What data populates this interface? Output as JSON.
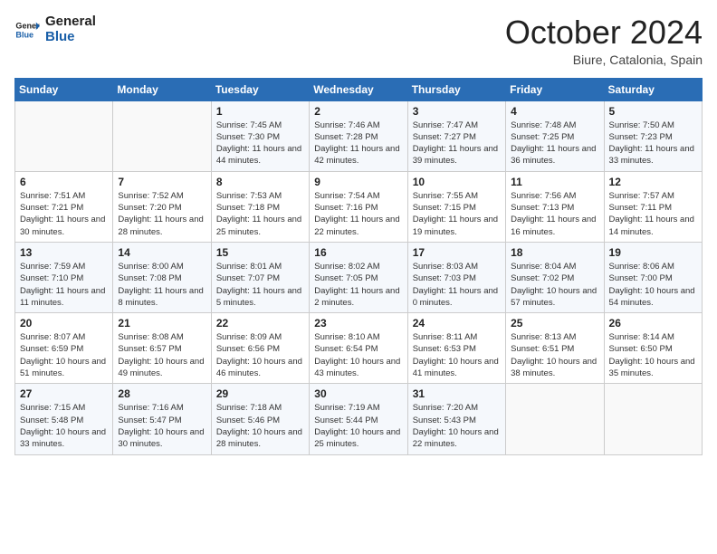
{
  "header": {
    "logo_line1": "General",
    "logo_line2": "Blue",
    "month": "October 2024",
    "location": "Biure, Catalonia, Spain"
  },
  "days_of_week": [
    "Sunday",
    "Monday",
    "Tuesday",
    "Wednesday",
    "Thursday",
    "Friday",
    "Saturday"
  ],
  "weeks": [
    [
      {
        "day": "",
        "info": ""
      },
      {
        "day": "",
        "info": ""
      },
      {
        "day": "1",
        "info": "Sunrise: 7:45 AM\nSunset: 7:30 PM\nDaylight: 11 hours and 44 minutes."
      },
      {
        "day": "2",
        "info": "Sunrise: 7:46 AM\nSunset: 7:28 PM\nDaylight: 11 hours and 42 minutes."
      },
      {
        "day": "3",
        "info": "Sunrise: 7:47 AM\nSunset: 7:27 PM\nDaylight: 11 hours and 39 minutes."
      },
      {
        "day": "4",
        "info": "Sunrise: 7:48 AM\nSunset: 7:25 PM\nDaylight: 11 hours and 36 minutes."
      },
      {
        "day": "5",
        "info": "Sunrise: 7:50 AM\nSunset: 7:23 PM\nDaylight: 11 hours and 33 minutes."
      }
    ],
    [
      {
        "day": "6",
        "info": "Sunrise: 7:51 AM\nSunset: 7:21 PM\nDaylight: 11 hours and 30 minutes."
      },
      {
        "day": "7",
        "info": "Sunrise: 7:52 AM\nSunset: 7:20 PM\nDaylight: 11 hours and 28 minutes."
      },
      {
        "day": "8",
        "info": "Sunrise: 7:53 AM\nSunset: 7:18 PM\nDaylight: 11 hours and 25 minutes."
      },
      {
        "day": "9",
        "info": "Sunrise: 7:54 AM\nSunset: 7:16 PM\nDaylight: 11 hours and 22 minutes."
      },
      {
        "day": "10",
        "info": "Sunrise: 7:55 AM\nSunset: 7:15 PM\nDaylight: 11 hours and 19 minutes."
      },
      {
        "day": "11",
        "info": "Sunrise: 7:56 AM\nSunset: 7:13 PM\nDaylight: 11 hours and 16 minutes."
      },
      {
        "day": "12",
        "info": "Sunrise: 7:57 AM\nSunset: 7:11 PM\nDaylight: 11 hours and 14 minutes."
      }
    ],
    [
      {
        "day": "13",
        "info": "Sunrise: 7:59 AM\nSunset: 7:10 PM\nDaylight: 11 hours and 11 minutes."
      },
      {
        "day": "14",
        "info": "Sunrise: 8:00 AM\nSunset: 7:08 PM\nDaylight: 11 hours and 8 minutes."
      },
      {
        "day": "15",
        "info": "Sunrise: 8:01 AM\nSunset: 7:07 PM\nDaylight: 11 hours and 5 minutes."
      },
      {
        "day": "16",
        "info": "Sunrise: 8:02 AM\nSunset: 7:05 PM\nDaylight: 11 hours and 2 minutes."
      },
      {
        "day": "17",
        "info": "Sunrise: 8:03 AM\nSunset: 7:03 PM\nDaylight: 11 hours and 0 minutes."
      },
      {
        "day": "18",
        "info": "Sunrise: 8:04 AM\nSunset: 7:02 PM\nDaylight: 10 hours and 57 minutes."
      },
      {
        "day": "19",
        "info": "Sunrise: 8:06 AM\nSunset: 7:00 PM\nDaylight: 10 hours and 54 minutes."
      }
    ],
    [
      {
        "day": "20",
        "info": "Sunrise: 8:07 AM\nSunset: 6:59 PM\nDaylight: 10 hours and 51 minutes."
      },
      {
        "day": "21",
        "info": "Sunrise: 8:08 AM\nSunset: 6:57 PM\nDaylight: 10 hours and 49 minutes."
      },
      {
        "day": "22",
        "info": "Sunrise: 8:09 AM\nSunset: 6:56 PM\nDaylight: 10 hours and 46 minutes."
      },
      {
        "day": "23",
        "info": "Sunrise: 8:10 AM\nSunset: 6:54 PM\nDaylight: 10 hours and 43 minutes."
      },
      {
        "day": "24",
        "info": "Sunrise: 8:11 AM\nSunset: 6:53 PM\nDaylight: 10 hours and 41 minutes."
      },
      {
        "day": "25",
        "info": "Sunrise: 8:13 AM\nSunset: 6:51 PM\nDaylight: 10 hours and 38 minutes."
      },
      {
        "day": "26",
        "info": "Sunrise: 8:14 AM\nSunset: 6:50 PM\nDaylight: 10 hours and 35 minutes."
      }
    ],
    [
      {
        "day": "27",
        "info": "Sunrise: 7:15 AM\nSunset: 5:48 PM\nDaylight: 10 hours and 33 minutes."
      },
      {
        "day": "28",
        "info": "Sunrise: 7:16 AM\nSunset: 5:47 PM\nDaylight: 10 hours and 30 minutes."
      },
      {
        "day": "29",
        "info": "Sunrise: 7:18 AM\nSunset: 5:46 PM\nDaylight: 10 hours and 28 minutes."
      },
      {
        "day": "30",
        "info": "Sunrise: 7:19 AM\nSunset: 5:44 PM\nDaylight: 10 hours and 25 minutes."
      },
      {
        "day": "31",
        "info": "Sunrise: 7:20 AM\nSunset: 5:43 PM\nDaylight: 10 hours and 22 minutes."
      },
      {
        "day": "",
        "info": ""
      },
      {
        "day": "",
        "info": ""
      }
    ]
  ]
}
